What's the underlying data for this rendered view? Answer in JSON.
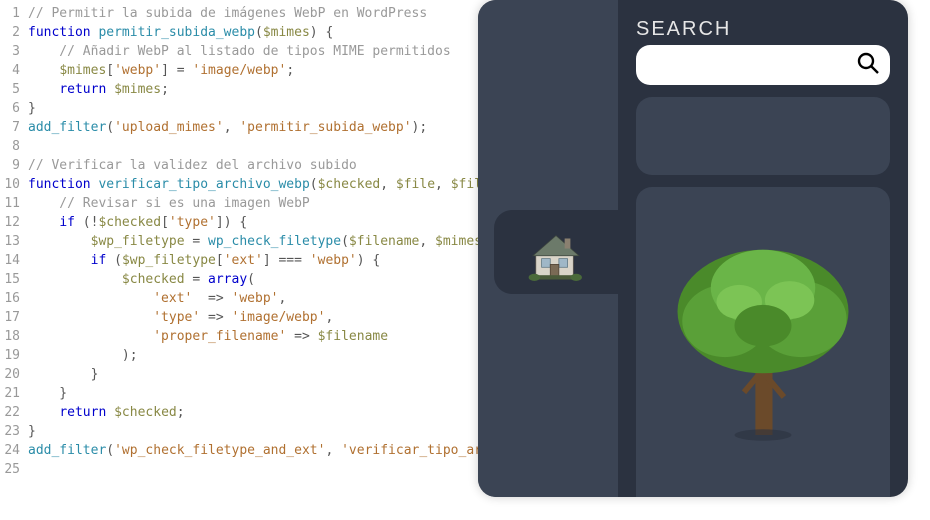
{
  "code": [
    [
      {
        "t": "// Permitir la subida de imágenes WebP en WordPress",
        "c": "c-comment"
      }
    ],
    [
      {
        "t": "function ",
        "c": "c-keyword"
      },
      {
        "t": "permitir_subida_webp",
        "c": "c-funcname"
      },
      {
        "t": "(",
        "c": "c-punct"
      },
      {
        "t": "$mimes",
        "c": "c-var"
      },
      {
        "t": ") {",
        "c": "c-punct"
      }
    ],
    [
      {
        "t": "    // Añadir WebP al listado de tipos MIME permitidos",
        "c": "c-comment"
      }
    ],
    [
      {
        "t": "    ",
        "c": ""
      },
      {
        "t": "$mimes",
        "c": "c-var"
      },
      {
        "t": "[",
        "c": "c-punct"
      },
      {
        "t": "'webp'",
        "c": "c-string"
      },
      {
        "t": "] = ",
        "c": "c-punct"
      },
      {
        "t": "'image/webp'",
        "c": "c-string"
      },
      {
        "t": ";",
        "c": "c-punct"
      }
    ],
    [
      {
        "t": "    ",
        "c": ""
      },
      {
        "t": "return ",
        "c": "c-keyword"
      },
      {
        "t": "$mimes",
        "c": "c-var"
      },
      {
        "t": ";",
        "c": "c-punct"
      }
    ],
    [
      {
        "t": "}",
        "c": "c-punct"
      }
    ],
    [
      {
        "t": "add_filter",
        "c": "c-funcname"
      },
      {
        "t": "(",
        "c": "c-punct"
      },
      {
        "t": "'upload_mimes'",
        "c": "c-string"
      },
      {
        "t": ", ",
        "c": "c-punct"
      },
      {
        "t": "'permitir_subida_webp'",
        "c": "c-string"
      },
      {
        "t": ");",
        "c": "c-punct"
      }
    ],
    [],
    [
      {
        "t": "// Verificar la validez del archivo subido",
        "c": "c-comment"
      }
    ],
    [
      {
        "t": "function ",
        "c": "c-keyword"
      },
      {
        "t": "verificar_tipo_archivo_webp",
        "c": "c-funcname"
      },
      {
        "t": "(",
        "c": "c-punct"
      },
      {
        "t": "$checked",
        "c": "c-var"
      },
      {
        "t": ", ",
        "c": "c-punct"
      },
      {
        "t": "$file",
        "c": "c-var"
      },
      {
        "t": ", ",
        "c": "c-punct"
      },
      {
        "t": "$filename",
        "c": "c-var"
      }
    ],
    [
      {
        "t": "    // Revisar si es una imagen WebP",
        "c": "c-comment"
      }
    ],
    [
      {
        "t": "    ",
        "c": ""
      },
      {
        "t": "if ",
        "c": "c-keyword"
      },
      {
        "t": "(!",
        "c": "c-punct"
      },
      {
        "t": "$checked",
        "c": "c-var"
      },
      {
        "t": "[",
        "c": "c-punct"
      },
      {
        "t": "'type'",
        "c": "c-string"
      },
      {
        "t": "]) {",
        "c": "c-punct"
      }
    ],
    [
      {
        "t": "        ",
        "c": ""
      },
      {
        "t": "$wp_filetype",
        "c": "c-var"
      },
      {
        "t": " = ",
        "c": "c-punct"
      },
      {
        "t": "wp_check_filetype",
        "c": "c-funcname"
      },
      {
        "t": "(",
        "c": "c-punct"
      },
      {
        "t": "$filename",
        "c": "c-var"
      },
      {
        "t": ", ",
        "c": "c-punct"
      },
      {
        "t": "$mimes",
        "c": "c-var"
      },
      {
        "t": ");",
        "c": "c-punct"
      }
    ],
    [
      {
        "t": "        ",
        "c": ""
      },
      {
        "t": "if ",
        "c": "c-keyword"
      },
      {
        "t": "(",
        "c": "c-punct"
      },
      {
        "t": "$wp_filetype",
        "c": "c-var"
      },
      {
        "t": "[",
        "c": "c-punct"
      },
      {
        "t": "'ext'",
        "c": "c-string"
      },
      {
        "t": "] === ",
        "c": "c-punct"
      },
      {
        "t": "'webp'",
        "c": "c-string"
      },
      {
        "t": ") {",
        "c": "c-punct"
      }
    ],
    [
      {
        "t": "            ",
        "c": ""
      },
      {
        "t": "$checked",
        "c": "c-var"
      },
      {
        "t": " = ",
        "c": "c-punct"
      },
      {
        "t": "array",
        "c": "c-keyword"
      },
      {
        "t": "(",
        "c": "c-punct"
      }
    ],
    [
      {
        "t": "                ",
        "c": ""
      },
      {
        "t": "'ext'",
        "c": "c-string"
      },
      {
        "t": "  => ",
        "c": "c-punct"
      },
      {
        "t": "'webp'",
        "c": "c-string"
      },
      {
        "t": ",",
        "c": "c-punct"
      }
    ],
    [
      {
        "t": "                ",
        "c": ""
      },
      {
        "t": "'type'",
        "c": "c-string"
      },
      {
        "t": " => ",
        "c": "c-punct"
      },
      {
        "t": "'image/webp'",
        "c": "c-string"
      },
      {
        "t": ",",
        "c": "c-punct"
      }
    ],
    [
      {
        "t": "                ",
        "c": ""
      },
      {
        "t": "'proper_filename'",
        "c": "c-string"
      },
      {
        "t": " => ",
        "c": "c-punct"
      },
      {
        "t": "$filename",
        "c": "c-var"
      }
    ],
    [
      {
        "t": "            );",
        "c": "c-punct"
      }
    ],
    [
      {
        "t": "        }",
        "c": "c-punct"
      }
    ],
    [
      {
        "t": "    }",
        "c": "c-punct"
      }
    ],
    [
      {
        "t": "    ",
        "c": ""
      },
      {
        "t": "return ",
        "c": "c-keyword"
      },
      {
        "t": "$checked",
        "c": "c-var"
      },
      {
        "t": ";",
        "c": "c-punct"
      }
    ],
    [
      {
        "t": "}",
        "c": "c-punct"
      }
    ],
    [
      {
        "t": "add_filter",
        "c": "c-funcname"
      },
      {
        "t": "(",
        "c": "c-punct"
      },
      {
        "t": "'wp_check_filetype_and_ext'",
        "c": "c-string"
      },
      {
        "t": ", ",
        "c": "c-punct"
      },
      {
        "t": "'verificar_tipo_archivo_webp'",
        "c": "c-string"
      }
    ],
    []
  ],
  "panel": {
    "search_label": "SEARCH",
    "search_placeholder": "",
    "sidebar_icon": "house-icon",
    "main_image": "tree-icon"
  }
}
